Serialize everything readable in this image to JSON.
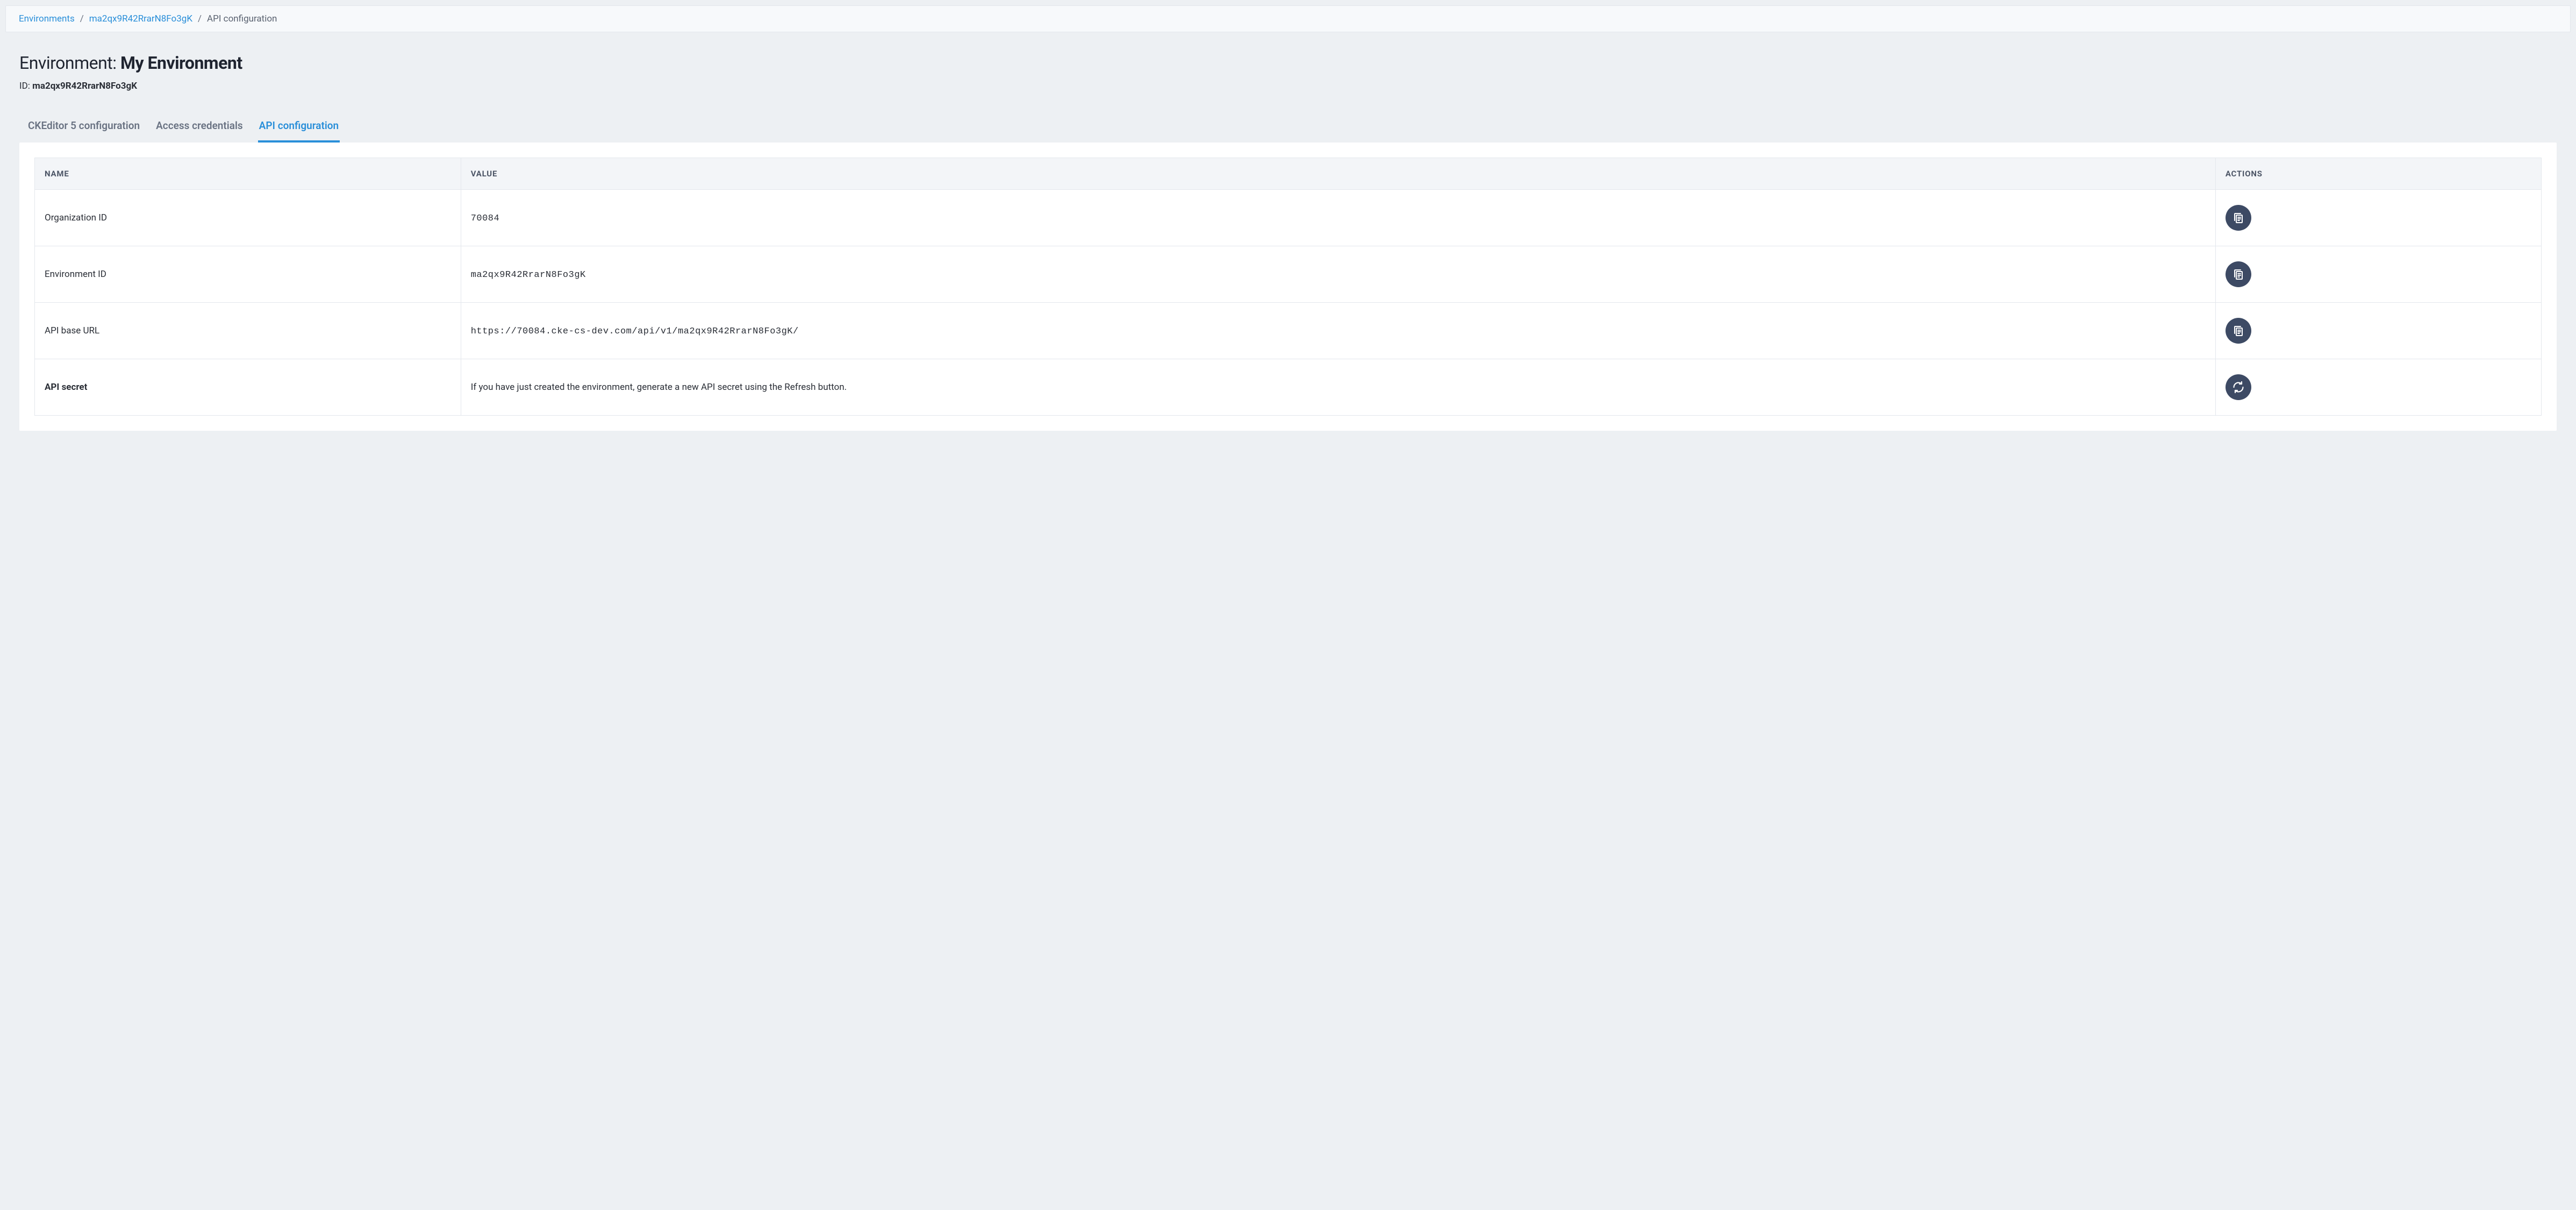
{
  "breadcrumb": {
    "items": [
      {
        "label": "Environments",
        "link": true
      },
      {
        "label": "ma2qx9R42RrarN8Fo3gK",
        "link": true
      },
      {
        "label": "API configuration",
        "link": false
      }
    ],
    "separator": "/"
  },
  "header": {
    "title_prefix": "Environment: ",
    "title_name": "My Environment",
    "id_label": "ID: ",
    "id_value": "ma2qx9R42RrarN8Fo3gK"
  },
  "tabs": [
    {
      "label": "CKEditor 5 configuration",
      "active": false
    },
    {
      "label": "Access credentials",
      "active": false
    },
    {
      "label": "API configuration",
      "active": true
    }
  ],
  "table": {
    "columns": {
      "name": "NAME",
      "value": "VALUE",
      "actions": "ACTIONS"
    },
    "rows": [
      {
        "name": "Organization ID",
        "value": "70084",
        "mono": true,
        "bold": false,
        "action": "copy"
      },
      {
        "name": "Environment ID",
        "value": "ma2qx9R42RrarN8Fo3gK",
        "mono": true,
        "bold": false,
        "action": "copy"
      },
      {
        "name": "API base URL",
        "value": "https://70084.cke-cs-dev.com/api/v1/ma2qx9R42RrarN8Fo3gK/",
        "mono": true,
        "bold": false,
        "action": "copy"
      },
      {
        "name": "API secret",
        "value": "If you have just created the environment, generate a new API secret using the Refresh button.",
        "mono": false,
        "bold": true,
        "action": "refresh"
      }
    ]
  }
}
